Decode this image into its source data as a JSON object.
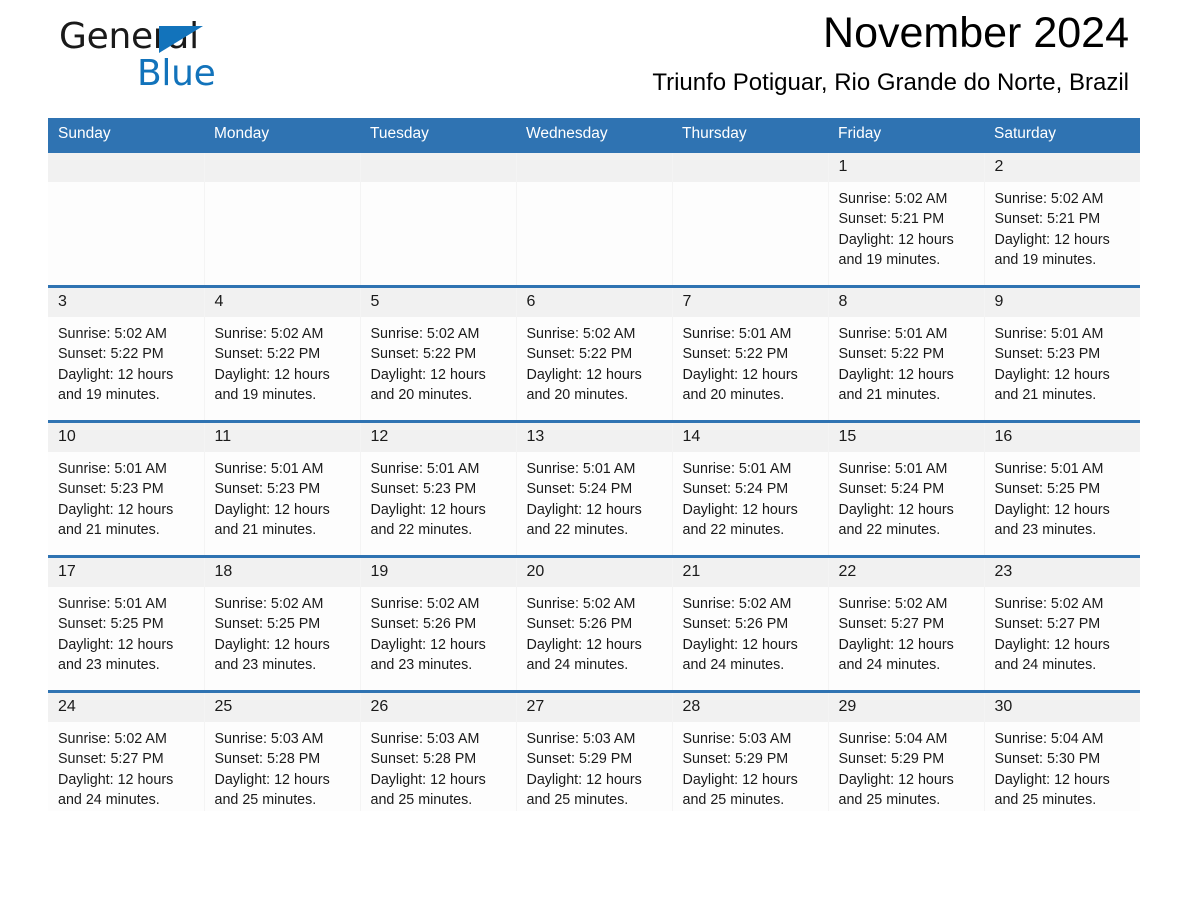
{
  "brand": {
    "name_dark": "General",
    "name_light": "Blue",
    "triangle_color": "#1273bb",
    "logo_icon": "general-blue-logo"
  },
  "header": {
    "title": "November 2024",
    "subtitle": "Triunfo Potiguar, Rio Grande do Norte, Brazil"
  },
  "colors": {
    "header_blue": "#2f73b2",
    "daynum_band": "#f1f1f1",
    "text": "#1a1a1a"
  },
  "calendar": {
    "weekday_headers": [
      "Sunday",
      "Monday",
      "Tuesday",
      "Wednesday",
      "Thursday",
      "Friday",
      "Saturday"
    ],
    "weeks": [
      [
        {
          "day": "",
          "sunrise": "",
          "sunset": "",
          "daylight": ""
        },
        {
          "day": "",
          "sunrise": "",
          "sunset": "",
          "daylight": ""
        },
        {
          "day": "",
          "sunrise": "",
          "sunset": "",
          "daylight": ""
        },
        {
          "day": "",
          "sunrise": "",
          "sunset": "",
          "daylight": ""
        },
        {
          "day": "",
          "sunrise": "",
          "sunset": "",
          "daylight": ""
        },
        {
          "day": "1",
          "sunrise": "Sunrise: 5:02 AM",
          "sunset": "Sunset: 5:21 PM",
          "daylight": "Daylight: 12 hours and 19 minutes."
        },
        {
          "day": "2",
          "sunrise": "Sunrise: 5:02 AM",
          "sunset": "Sunset: 5:21 PM",
          "daylight": "Daylight: 12 hours and 19 minutes."
        }
      ],
      [
        {
          "day": "3",
          "sunrise": "Sunrise: 5:02 AM",
          "sunset": "Sunset: 5:22 PM",
          "daylight": "Daylight: 12 hours and 19 minutes."
        },
        {
          "day": "4",
          "sunrise": "Sunrise: 5:02 AM",
          "sunset": "Sunset: 5:22 PM",
          "daylight": "Daylight: 12 hours and 19 minutes."
        },
        {
          "day": "5",
          "sunrise": "Sunrise: 5:02 AM",
          "sunset": "Sunset: 5:22 PM",
          "daylight": "Daylight: 12 hours and 20 minutes."
        },
        {
          "day": "6",
          "sunrise": "Sunrise: 5:02 AM",
          "sunset": "Sunset: 5:22 PM",
          "daylight": "Daylight: 12 hours and 20 minutes."
        },
        {
          "day": "7",
          "sunrise": "Sunrise: 5:01 AM",
          "sunset": "Sunset: 5:22 PM",
          "daylight": "Daylight: 12 hours and 20 minutes."
        },
        {
          "day": "8",
          "sunrise": "Sunrise: 5:01 AM",
          "sunset": "Sunset: 5:22 PM",
          "daylight": "Daylight: 12 hours and 21 minutes."
        },
        {
          "day": "9",
          "sunrise": "Sunrise: 5:01 AM",
          "sunset": "Sunset: 5:23 PM",
          "daylight": "Daylight: 12 hours and 21 minutes."
        }
      ],
      [
        {
          "day": "10",
          "sunrise": "Sunrise: 5:01 AM",
          "sunset": "Sunset: 5:23 PM",
          "daylight": "Daylight: 12 hours and 21 minutes."
        },
        {
          "day": "11",
          "sunrise": "Sunrise: 5:01 AM",
          "sunset": "Sunset: 5:23 PM",
          "daylight": "Daylight: 12 hours and 21 minutes."
        },
        {
          "day": "12",
          "sunrise": "Sunrise: 5:01 AM",
          "sunset": "Sunset: 5:23 PM",
          "daylight": "Daylight: 12 hours and 22 minutes."
        },
        {
          "day": "13",
          "sunrise": "Sunrise: 5:01 AM",
          "sunset": "Sunset: 5:24 PM",
          "daylight": "Daylight: 12 hours and 22 minutes."
        },
        {
          "day": "14",
          "sunrise": "Sunrise: 5:01 AM",
          "sunset": "Sunset: 5:24 PM",
          "daylight": "Daylight: 12 hours and 22 minutes."
        },
        {
          "day": "15",
          "sunrise": "Sunrise: 5:01 AM",
          "sunset": "Sunset: 5:24 PM",
          "daylight": "Daylight: 12 hours and 22 minutes."
        },
        {
          "day": "16",
          "sunrise": "Sunrise: 5:01 AM",
          "sunset": "Sunset: 5:25 PM",
          "daylight": "Daylight: 12 hours and 23 minutes."
        }
      ],
      [
        {
          "day": "17",
          "sunrise": "Sunrise: 5:01 AM",
          "sunset": "Sunset: 5:25 PM",
          "daylight": "Daylight: 12 hours and 23 minutes."
        },
        {
          "day": "18",
          "sunrise": "Sunrise: 5:02 AM",
          "sunset": "Sunset: 5:25 PM",
          "daylight": "Daylight: 12 hours and 23 minutes."
        },
        {
          "day": "19",
          "sunrise": "Sunrise: 5:02 AM",
          "sunset": "Sunset: 5:26 PM",
          "daylight": "Daylight: 12 hours and 23 minutes."
        },
        {
          "day": "20",
          "sunrise": "Sunrise: 5:02 AM",
          "sunset": "Sunset: 5:26 PM",
          "daylight": "Daylight: 12 hours and 24 minutes."
        },
        {
          "day": "21",
          "sunrise": "Sunrise: 5:02 AM",
          "sunset": "Sunset: 5:26 PM",
          "daylight": "Daylight: 12 hours and 24 minutes."
        },
        {
          "day": "22",
          "sunrise": "Sunrise: 5:02 AM",
          "sunset": "Sunset: 5:27 PM",
          "daylight": "Daylight: 12 hours and 24 minutes."
        },
        {
          "day": "23",
          "sunrise": "Sunrise: 5:02 AM",
          "sunset": "Sunset: 5:27 PM",
          "daylight": "Daylight: 12 hours and 24 minutes."
        }
      ],
      [
        {
          "day": "24",
          "sunrise": "Sunrise: 5:02 AM",
          "sunset": "Sunset: 5:27 PM",
          "daylight": "Daylight: 12 hours and 24 minutes."
        },
        {
          "day": "25",
          "sunrise": "Sunrise: 5:03 AM",
          "sunset": "Sunset: 5:28 PM",
          "daylight": "Daylight: 12 hours and 25 minutes."
        },
        {
          "day": "26",
          "sunrise": "Sunrise: 5:03 AM",
          "sunset": "Sunset: 5:28 PM",
          "daylight": "Daylight: 12 hours and 25 minutes."
        },
        {
          "day": "27",
          "sunrise": "Sunrise: 5:03 AM",
          "sunset": "Sunset: 5:29 PM",
          "daylight": "Daylight: 12 hours and 25 minutes."
        },
        {
          "day": "28",
          "sunrise": "Sunrise: 5:03 AM",
          "sunset": "Sunset: 5:29 PM",
          "daylight": "Daylight: 12 hours and 25 minutes."
        },
        {
          "day": "29",
          "sunrise": "Sunrise: 5:04 AM",
          "sunset": "Sunset: 5:29 PM",
          "daylight": "Daylight: 12 hours and 25 minutes."
        },
        {
          "day": "30",
          "sunrise": "Sunrise: 5:04 AM",
          "sunset": "Sunset: 5:30 PM",
          "daylight": "Daylight: 12 hours and 25 minutes."
        }
      ]
    ]
  }
}
